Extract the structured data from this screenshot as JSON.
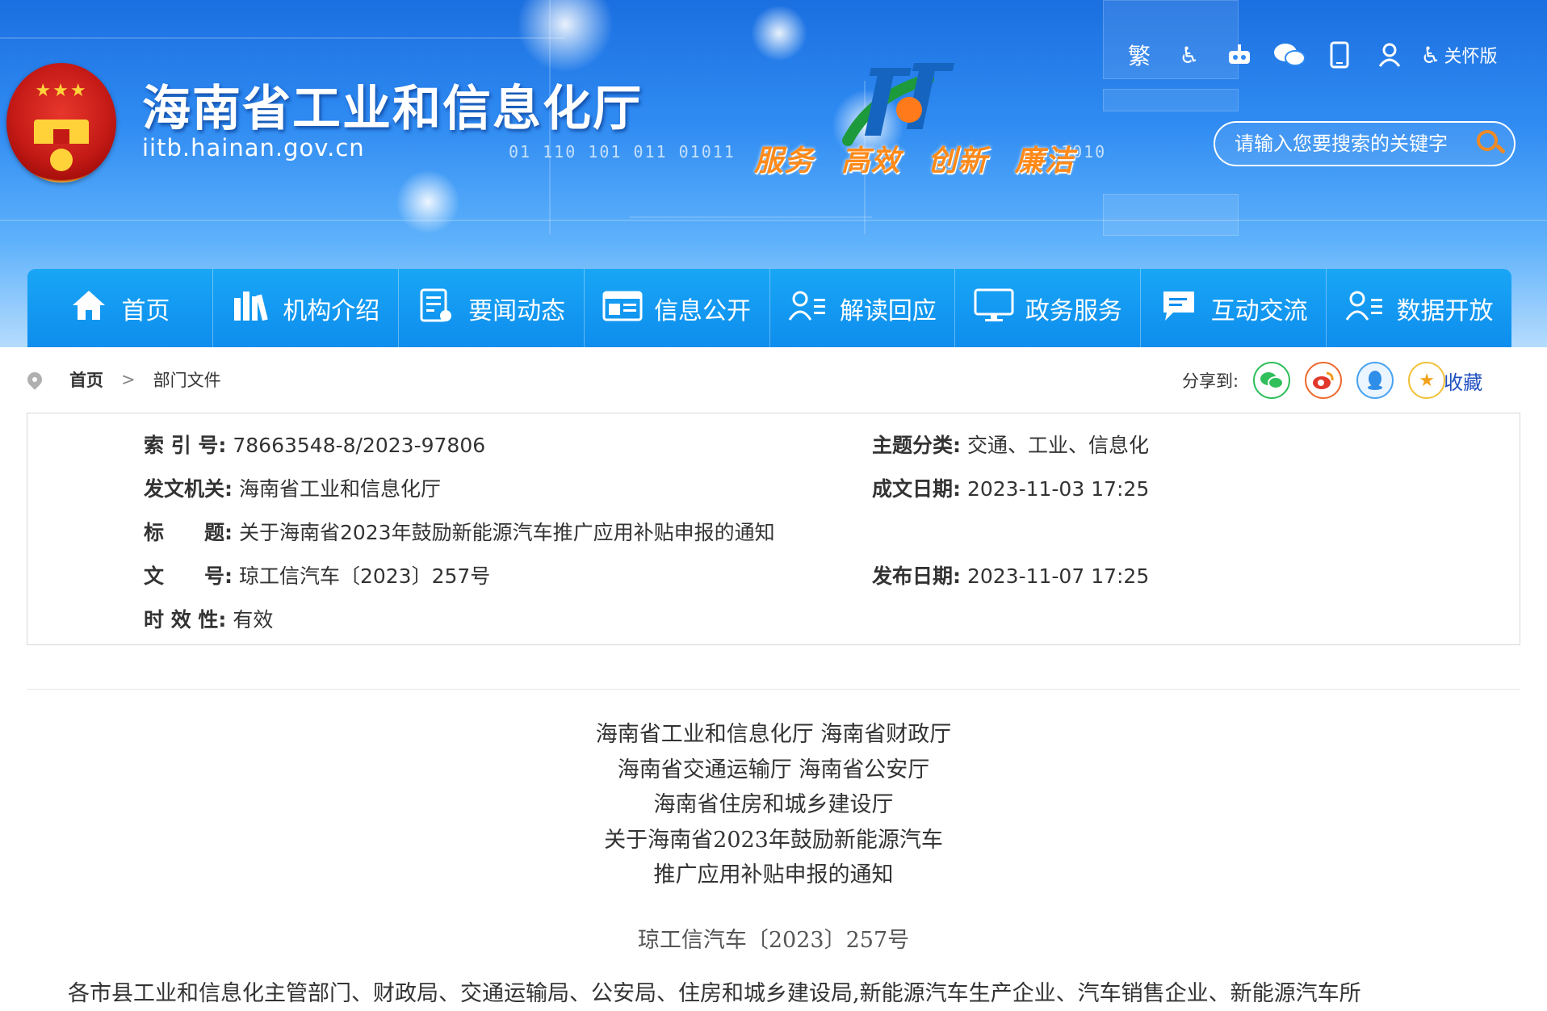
{
  "header": {
    "site_title": "海南省工业和信息化厅",
    "site_url": "iitb.hainan.gov.cn",
    "binary_left": "01 110 101 011 01011",
    "binary_right": "11010",
    "slogan": [
      "服务",
      "高效",
      "创新",
      "廉洁"
    ],
    "tools": {
      "traditional": "繁",
      "accessibility_icon": "wheelchair-icon",
      "robot_icon": "robot-icon",
      "wechat_icon": "wechat-icon",
      "mobile_icon": "mobile-icon",
      "user_icon": "user-icon",
      "care_label": "关怀版"
    },
    "search_placeholder": "请输入您要搜索的关键字"
  },
  "nav": {
    "items": [
      {
        "label": "首页",
        "icon": "home-icon"
      },
      {
        "label": "机构介绍",
        "icon": "books-icon"
      },
      {
        "label": "要闻动态",
        "icon": "news-icon"
      },
      {
        "label": "信息公开",
        "icon": "folder-icon"
      },
      {
        "label": "解读回应",
        "icon": "user-list-icon"
      },
      {
        "label": "政务服务",
        "icon": "monitor-icon"
      },
      {
        "label": "互动交流",
        "icon": "chat-icon"
      },
      {
        "label": "数据开放",
        "icon": "user-list-icon"
      }
    ]
  },
  "breadcrumb": {
    "home": "首页",
    "separator": ">",
    "current": "部门文件"
  },
  "share": {
    "label": "分享到:",
    "favorite": "收藏"
  },
  "info": {
    "index_no_label": "索 引 号:",
    "index_no": "78663548-8/2023-97806",
    "topic_label": "主题分类:",
    "topic": "交通、工业、信息化",
    "issuer_label": "发文机关:",
    "issuer": "海南省工业和信息化厅",
    "created_label": "成文日期:",
    "created": "2023-11-03 17:25",
    "title_label": "标　　题:",
    "title": "关于海南省2023年鼓励新能源汽车推广应用补贴申报的通知",
    "doc_no_label": "文　　号:",
    "doc_no": "琼工信汽车〔2023〕257号",
    "published_label": "发布日期:",
    "published": "2023-11-07 17:25",
    "validity_label": "时 效 性:",
    "validity": "有效"
  },
  "article": {
    "title_lines": [
      "海南省工业和信息化厅  海南省财政厅",
      "海南省交通运输厅  海南省公安厅",
      "海南省住房和城乡建设厅",
      "关于海南省2023年鼓励新能源汽车",
      "推广应用补贴申报的通知"
    ],
    "doc_no": "琼工信汽车〔2023〕257号",
    "body_first_line": "各市县工业和信息化主管部门、财政局、交通运输局、公安局、住房和城乡建设局,新能源汽车生产企业、汽车销售企业、新能源汽车所"
  },
  "colors": {
    "nav_bg": "#0e8ded",
    "slogan": "#ff8a1a",
    "search_icon": "#f08a24"
  }
}
